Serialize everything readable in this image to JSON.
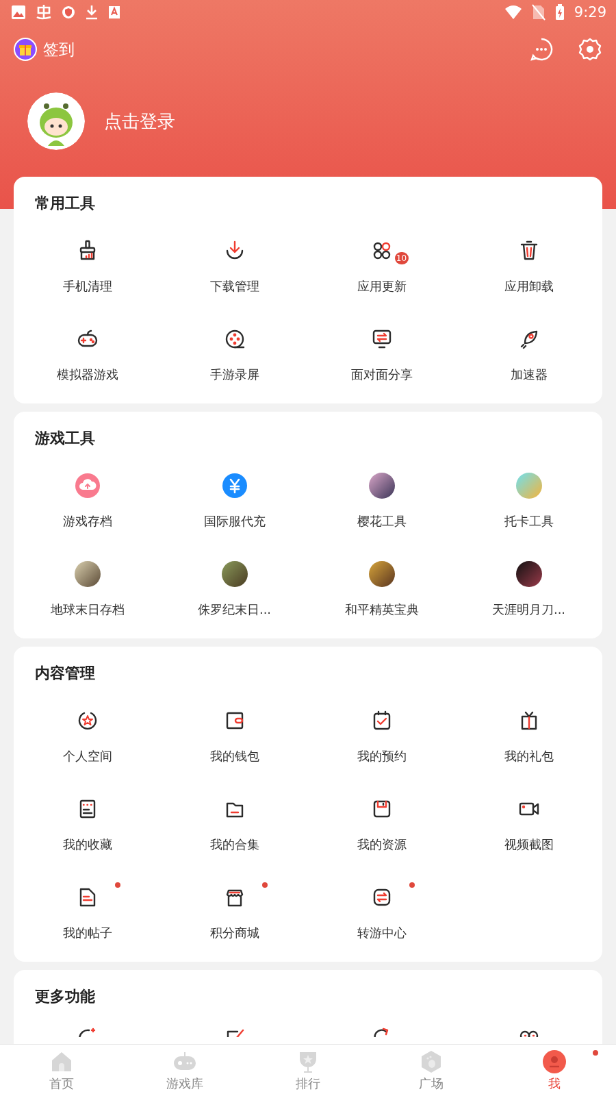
{
  "status_bar": {
    "time": "9:29"
  },
  "header": {
    "checkin": "签到",
    "login": "点击登录"
  },
  "sections": [
    {
      "title": "常用工具",
      "items": [
        {
          "label": "手机清理",
          "kind": "icon"
        },
        {
          "label": "下载管理",
          "kind": "icon"
        },
        {
          "label": "应用更新",
          "kind": "icon",
          "badge": "10"
        },
        {
          "label": "应用卸载",
          "kind": "icon"
        },
        {
          "label": "模拟器游戏",
          "kind": "icon"
        },
        {
          "label": "手游录屏",
          "kind": "icon"
        },
        {
          "label": "面对面分享",
          "kind": "icon"
        },
        {
          "label": "加速器",
          "kind": "icon"
        }
      ]
    },
    {
      "title": "游戏工具",
      "items": [
        {
          "label": "游戏存档",
          "kind": "icon"
        },
        {
          "label": "国际服代充",
          "kind": "icon"
        },
        {
          "label": "樱花工具",
          "kind": "thumbnail"
        },
        {
          "label": "托卡工具",
          "kind": "thumbnail"
        },
        {
          "label": "地球末日存档",
          "kind": "thumbnail"
        },
        {
          "label": "侏罗纪末日...",
          "kind": "thumbnail"
        },
        {
          "label": "和平精英宝典",
          "kind": "thumbnail"
        },
        {
          "label": "天涯明月刀...",
          "kind": "thumbnail"
        }
      ]
    },
    {
      "title": "内容管理",
      "items": [
        {
          "label": "个人空间",
          "kind": "icon",
          "dot": false
        },
        {
          "label": "我的钱包",
          "kind": "icon",
          "dot": false
        },
        {
          "label": "我的预约",
          "kind": "icon",
          "dot": false
        },
        {
          "label": "我的礼包",
          "kind": "icon",
          "dot": false
        },
        {
          "label": "我的收藏",
          "kind": "icon",
          "dot": false
        },
        {
          "label": "我的合集",
          "kind": "icon",
          "dot": false
        },
        {
          "label": "我的资源",
          "kind": "icon",
          "dot": false
        },
        {
          "label": "视频截图",
          "kind": "icon",
          "dot": false
        },
        {
          "label": "我的帖子",
          "kind": "icon",
          "dot": true
        },
        {
          "label": "积分商城",
          "kind": "icon",
          "dot": true
        },
        {
          "label": "转游中心",
          "kind": "icon",
          "dot": true
        }
      ]
    },
    {
      "title": "更多功能"
    }
  ],
  "nav": [
    {
      "label": "首页",
      "selected": false,
      "dot": false
    },
    {
      "label": "游戏库",
      "selected": false,
      "dot": false
    },
    {
      "label": "排行",
      "selected": false,
      "dot": false
    },
    {
      "label": "广场",
      "selected": false,
      "dot": false
    },
    {
      "label": "我",
      "selected": true,
      "dot": true
    }
  ]
}
